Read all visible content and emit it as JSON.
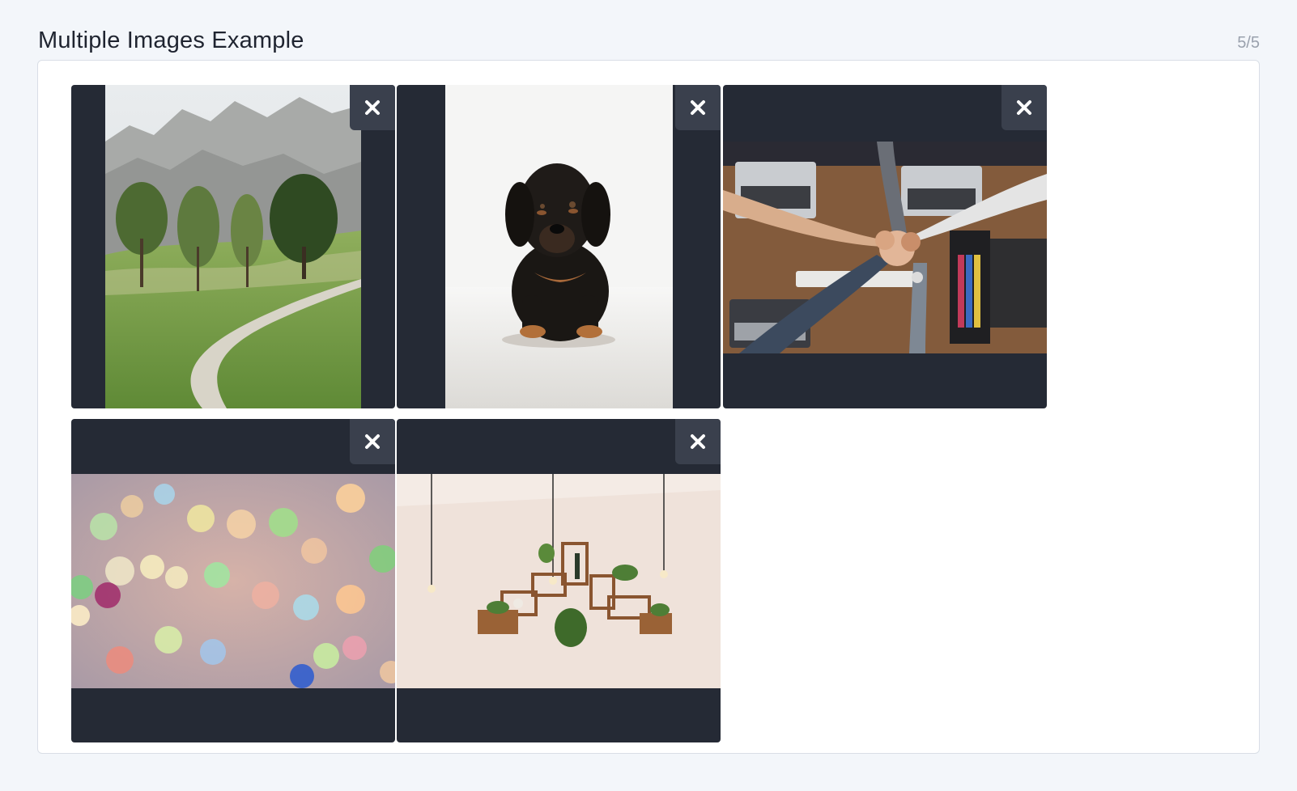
{
  "header": {
    "title": "Multiple Images Example",
    "count": "5/5"
  },
  "images": [
    {
      "name": "mountain-path-photo"
    },
    {
      "name": "puppy-photo"
    },
    {
      "name": "team-fist-bump-photo"
    },
    {
      "name": "bokeh-lights-photo"
    },
    {
      "name": "wall-shelves-photo"
    }
  ],
  "colors": {
    "background": "#f3f6fa",
    "tile": "#252a35",
    "close_button": "#3a404d",
    "counter": "#9aa1ad"
  },
  "icons": {
    "remove": "close-icon"
  }
}
